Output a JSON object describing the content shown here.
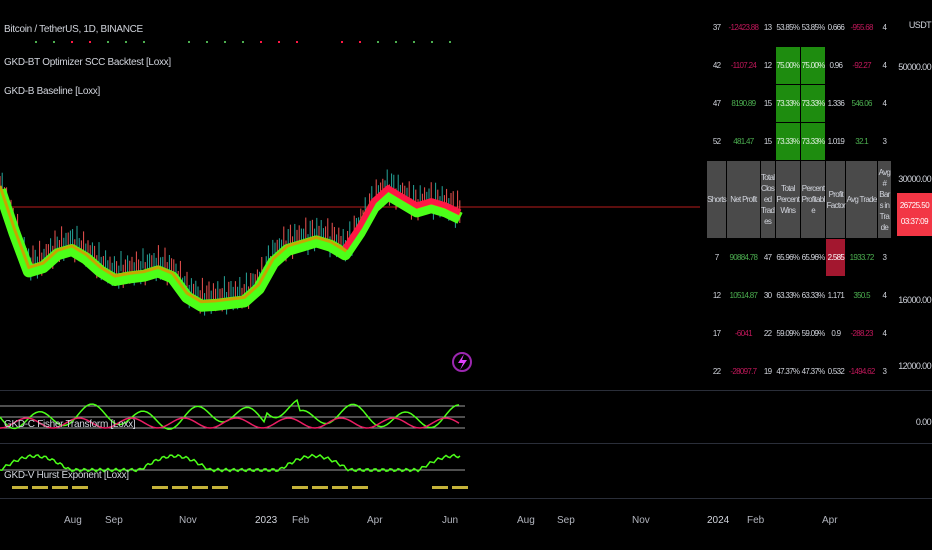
{
  "legend": {
    "symbol": "Bitcoin / TetherUS, 1D, BINANCE",
    "ind1": "GKD-BT Optimizer SCC Backtest [Loxx]",
    "ind2": "GKD-B Baseline [Loxx]",
    "osc1": "GKD-C Fisher Transform [Loxx]",
    "osc2": "GKD-V Hurst Exponent [Loxx]"
  },
  "price_axis": {
    "currency": "USDT",
    "ticks": [
      "50000.00",
      "30000.00",
      "16000.00",
      "12000.00"
    ],
    "osc_tick": "0.00",
    "last_price": "26725.50",
    "countdown": "03:37:09"
  },
  "time_axis": [
    "Aug",
    "Sep",
    "Nov",
    "2023",
    "Feb",
    "Apr",
    "Jun",
    "Aug",
    "Sep",
    "Nov",
    "2024",
    "Feb",
    "Apr"
  ],
  "table": {
    "headers": [
      "Shorts",
      "Net Profit",
      "Total Closed Trades",
      "Total Percent Wins",
      "Percent Profitable",
      "Profit Factor",
      "Avg Trade",
      "Avg # Bars in Trade"
    ],
    "top_rows": [
      {
        "cells": [
          "37",
          "-12423.88",
          "13",
          "53.85%",
          "53.85%",
          "0.666",
          "-955.68",
          "4"
        ],
        "pl": "neg",
        "hl": false
      },
      {
        "cells": [
          "42",
          "-1107.24",
          "12",
          "75.00%",
          "75.00%",
          "0.96",
          "-92.27",
          "4"
        ],
        "pl": "neg",
        "hl": true
      },
      {
        "cells": [
          "47",
          "8190.89",
          "15",
          "73.33%",
          "73.33%",
          "1.336",
          "546.06",
          "4"
        ],
        "pl": "pos",
        "hl": true
      },
      {
        "cells": [
          "52",
          "481.47",
          "15",
          "73.33%",
          "73.33%",
          "1.019",
          "32.1",
          "3"
        ],
        "pl": "pos",
        "hl": true
      }
    ],
    "bottom_rows": [
      {
        "cells": [
          "7",
          "90884.78",
          "47",
          "65.96%",
          "65.96%",
          "2.585",
          "1933.72",
          "3"
        ],
        "pl": "pos",
        "pf_hl": true
      },
      {
        "cells": [
          "12",
          "10514.87",
          "30",
          "63.33%",
          "63.33%",
          "1.171",
          "350.5",
          "4"
        ],
        "pl": "pos",
        "pf_hl": false
      },
      {
        "cells": [
          "17",
          "-6041",
          "22",
          "59.09%",
          "59.09%",
          "0.9",
          "-288.23",
          "4"
        ],
        "pl": "neg",
        "pf_hl": false
      },
      {
        "cells": [
          "22",
          "-28097.7",
          "19",
          "47.37%",
          "47.37%",
          "0.532",
          "-1494.62",
          "3"
        ],
        "pl": "neg",
        "pf_hl": false
      }
    ]
  },
  "colors": {
    "bull": "#4cff19",
    "bear": "#ff1744",
    "highlight_green": "#1e8c0f",
    "highlight_red": "#a3172f",
    "price_tag": "#f23645"
  },
  "chart_data": {
    "type": "line",
    "series": [
      {
        "name": "BTCUSDT baseline",
        "values": [
          30000,
          25000,
          20500,
          21000,
          22500,
          23000,
          22000,
          20500,
          19500,
          19800,
          20000,
          20500,
          19800,
          17500,
          16500,
          16600,
          16800,
          17000,
          18500,
          21500,
          23000,
          23500,
          24000,
          23500,
          22500,
          25000,
          28000,
          29500,
          28500,
          27500,
          28000,
          27500,
          26700
        ]
      }
    ]
  }
}
